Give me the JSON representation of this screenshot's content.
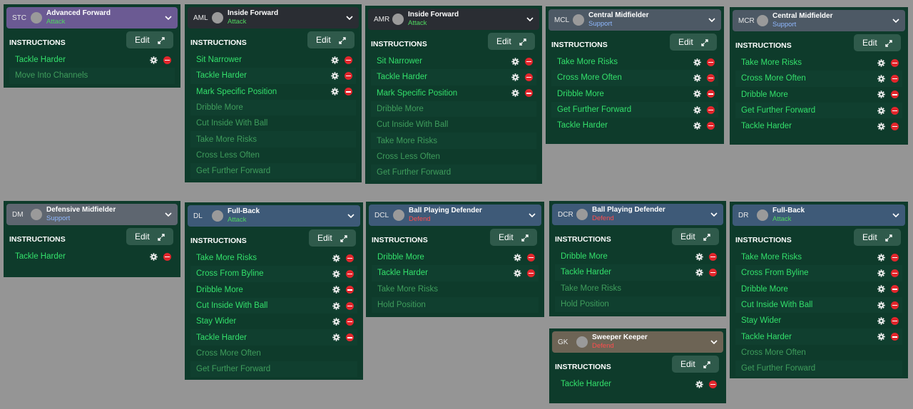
{
  "panels": [
    {
      "code": "STC",
      "role": "Advanced Forward",
      "duty": "Attack",
      "instructions_label": "INSTRUCTIONS",
      "edit_label": "Edit",
      "items": [
        {
          "label": "Tackle Harder",
          "active": true
        },
        {
          "label": "Move Into Channels",
          "active": false
        }
      ]
    },
    {
      "code": "AML",
      "role": "Inside Forward",
      "duty": "Attack",
      "instructions_label": "INSTRUCTIONS",
      "edit_label": "Edit",
      "items": [
        {
          "label": "Sit Narrower",
          "active": true
        },
        {
          "label": "Tackle Harder",
          "active": true
        },
        {
          "label": "Mark Specific Position",
          "active": true
        },
        {
          "label": "Dribble More",
          "active": false
        },
        {
          "label": "Cut Inside With Ball",
          "active": false
        },
        {
          "label": "Take More Risks",
          "active": false
        },
        {
          "label": "Cross Less Often",
          "active": false
        },
        {
          "label": "Get Further Forward",
          "active": false
        }
      ]
    },
    {
      "code": "AMR",
      "role": "Inside Forward",
      "duty": "Attack",
      "instructions_label": "INSTRUCTIONS",
      "edit_label": "Edit",
      "items": [
        {
          "label": "Sit Narrower",
          "active": true
        },
        {
          "label": "Tackle Harder",
          "active": true
        },
        {
          "label": "Mark Specific Position",
          "active": true
        },
        {
          "label": "Dribble More",
          "active": false
        },
        {
          "label": "Cut Inside With Ball",
          "active": false
        },
        {
          "label": "Take More Risks",
          "active": false
        },
        {
          "label": "Cross Less Often",
          "active": false
        },
        {
          "label": "Get Further Forward",
          "active": false
        }
      ]
    },
    {
      "code": "MCL",
      "role": "Central Midfielder",
      "duty": "Support",
      "instructions_label": "INSTRUCTIONS",
      "edit_label": "Edit",
      "items": [
        {
          "label": "Take More Risks",
          "active": true
        },
        {
          "label": "Cross More Often",
          "active": true
        },
        {
          "label": "Dribble More",
          "active": true
        },
        {
          "label": "Get Further Forward",
          "active": true
        },
        {
          "label": "Tackle Harder",
          "active": true
        }
      ]
    },
    {
      "code": "MCR",
      "role": "Central Midfielder",
      "duty": "Support",
      "instructions_label": "INSTRUCTIONS",
      "edit_label": "Edit",
      "items": [
        {
          "label": "Take More Risks",
          "active": true
        },
        {
          "label": "Cross More Often",
          "active": true
        },
        {
          "label": "Dribble More",
          "active": true
        },
        {
          "label": "Get Further Forward",
          "active": true
        },
        {
          "label": "Tackle Harder",
          "active": true
        }
      ]
    },
    {
      "code": "DM",
      "role": "Defensive Midfielder",
      "duty": "Support",
      "instructions_label": "INSTRUCTIONS",
      "edit_label": "Edit",
      "items": [
        {
          "label": "Tackle Harder",
          "active": true
        }
      ]
    },
    {
      "code": "DL",
      "role": "Full-Back",
      "duty": "Attack",
      "instructions_label": "INSTRUCTIONS",
      "edit_label": "Edit",
      "items": [
        {
          "label": "Take More Risks",
          "active": true
        },
        {
          "label": "Cross From Byline",
          "active": true
        },
        {
          "label": "Dribble More",
          "active": true
        },
        {
          "label": "Cut Inside With Ball",
          "active": true
        },
        {
          "label": "Stay Wider",
          "active": true
        },
        {
          "label": "Tackle Harder",
          "active": true
        },
        {
          "label": "Cross More Often",
          "active": false
        },
        {
          "label": "Get Further Forward",
          "active": false
        }
      ]
    },
    {
      "code": "DCL",
      "role": "Ball Playing Defender",
      "duty": "Defend",
      "instructions_label": "INSTRUCTIONS",
      "edit_label": "Edit",
      "items": [
        {
          "label": "Dribble More",
          "active": true
        },
        {
          "label": "Tackle Harder",
          "active": true
        },
        {
          "label": "Take More Risks",
          "active": false
        },
        {
          "label": "Hold Position",
          "active": false
        }
      ]
    },
    {
      "code": "DCR",
      "role": "Ball Playing Defender",
      "duty": "Defend",
      "instructions_label": "INSTRUCTIONS",
      "edit_label": "Edit",
      "items": [
        {
          "label": "Dribble More",
          "active": true
        },
        {
          "label": "Tackle Harder",
          "active": true
        },
        {
          "label": "Take More Risks",
          "active": false
        },
        {
          "label": "Hold Position",
          "active": false
        }
      ]
    },
    {
      "code": "DR",
      "role": "Full-Back",
      "duty": "Attack",
      "instructions_label": "INSTRUCTIONS",
      "edit_label": "Edit",
      "items": [
        {
          "label": "Take More Risks",
          "active": true
        },
        {
          "label": "Cross From Byline",
          "active": true
        },
        {
          "label": "Dribble More",
          "active": true
        },
        {
          "label": "Cut Inside With Ball",
          "active": true
        },
        {
          "label": "Stay Wider",
          "active": true
        },
        {
          "label": "Tackle Harder",
          "active": true
        },
        {
          "label": "Cross More Often",
          "active": false
        },
        {
          "label": "Get Further Forward",
          "active": false
        }
      ]
    },
    {
      "code": "GK",
      "role": "Sweeper Keeper",
      "duty": "Defend",
      "instructions_label": "INSTRUCTIONS",
      "edit_label": "Edit",
      "items": [
        {
          "label": "Tackle Harder",
          "active": true
        }
      ]
    }
  ],
  "colors": {
    "panel_bg": "#0e3b2b",
    "active_text": "#33e06b",
    "inactive_text": "#3f9d5c",
    "remove": "#e2262c",
    "attack": "#4fd760",
    "support": "#8fb8ff",
    "defend": "#ff4d4d"
  },
  "icons": {
    "row_settings": "gear-icon",
    "row_remove": "remove-icon",
    "edit_expand": "expand-icon",
    "header_toggle": "chevron-down-icon"
  }
}
